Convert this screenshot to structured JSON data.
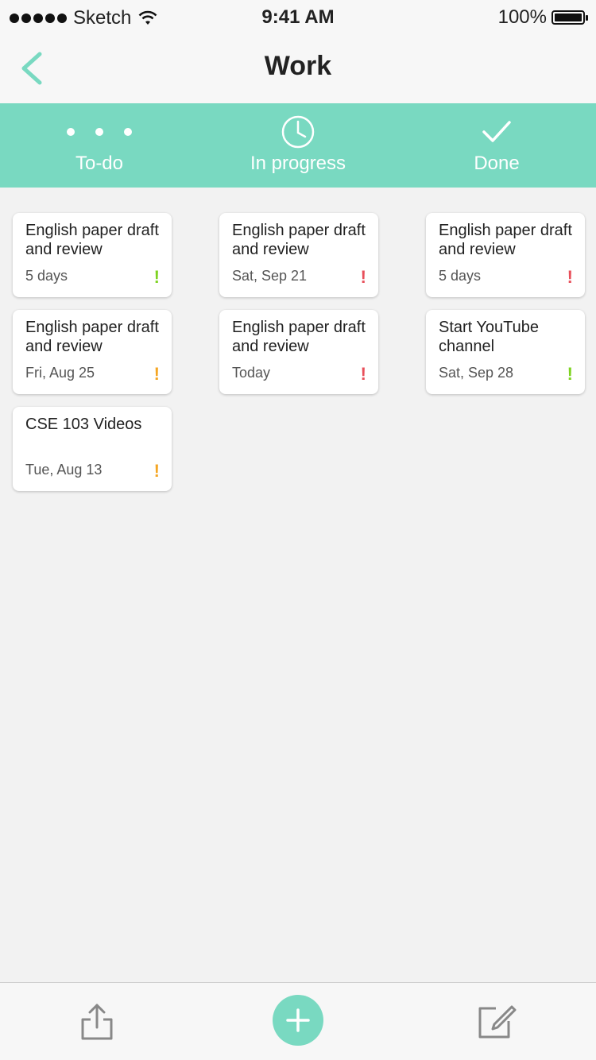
{
  "status_bar": {
    "carrier": "Sketch",
    "time": "9:41 AM",
    "battery": "100%"
  },
  "nav": {
    "title": "Work",
    "back_icon": "chevron-left-icon"
  },
  "tabs": [
    {
      "label": "To-do",
      "icon": "dots-icon"
    },
    {
      "label": "In progress",
      "icon": "clock-icon"
    },
    {
      "label": "Done",
      "icon": "checkmark-icon"
    }
  ],
  "columns": {
    "todo": [
      {
        "title": "English paper draft and review",
        "due": "5 days",
        "priority": "!",
        "priority_color": "#7ed321"
      },
      {
        "title": "English paper draft and review",
        "due": "Fri, Aug 25",
        "priority": "!",
        "priority_color": "#f5a623"
      },
      {
        "title": "CSE 103 Videos",
        "due": "Tue, Aug 13",
        "priority": "!",
        "priority_color": "#f5a623"
      }
    ],
    "in_progress": [
      {
        "title": "English paper draft and review",
        "due": "Sat, Sep 21",
        "priority": "!",
        "priority_color": "#e8505b"
      },
      {
        "title": "English paper draft and review",
        "due": "Today",
        "priority": "!",
        "priority_color": "#e8505b"
      }
    ],
    "done": [
      {
        "title": "English paper draft and review",
        "due": "5 days",
        "priority": "!",
        "priority_color": "#e8505b"
      },
      {
        "title": "Start YouTube channel",
        "due": "Sat, Sep 28",
        "priority": "!",
        "priority_color": "#7ed321"
      }
    ]
  },
  "bottom_bar": {
    "share_icon": "share-icon",
    "add_icon": "plus-icon",
    "edit_icon": "compose-icon"
  },
  "colors": {
    "accent": "#79d9c1",
    "background": "#f2f2f2"
  }
}
